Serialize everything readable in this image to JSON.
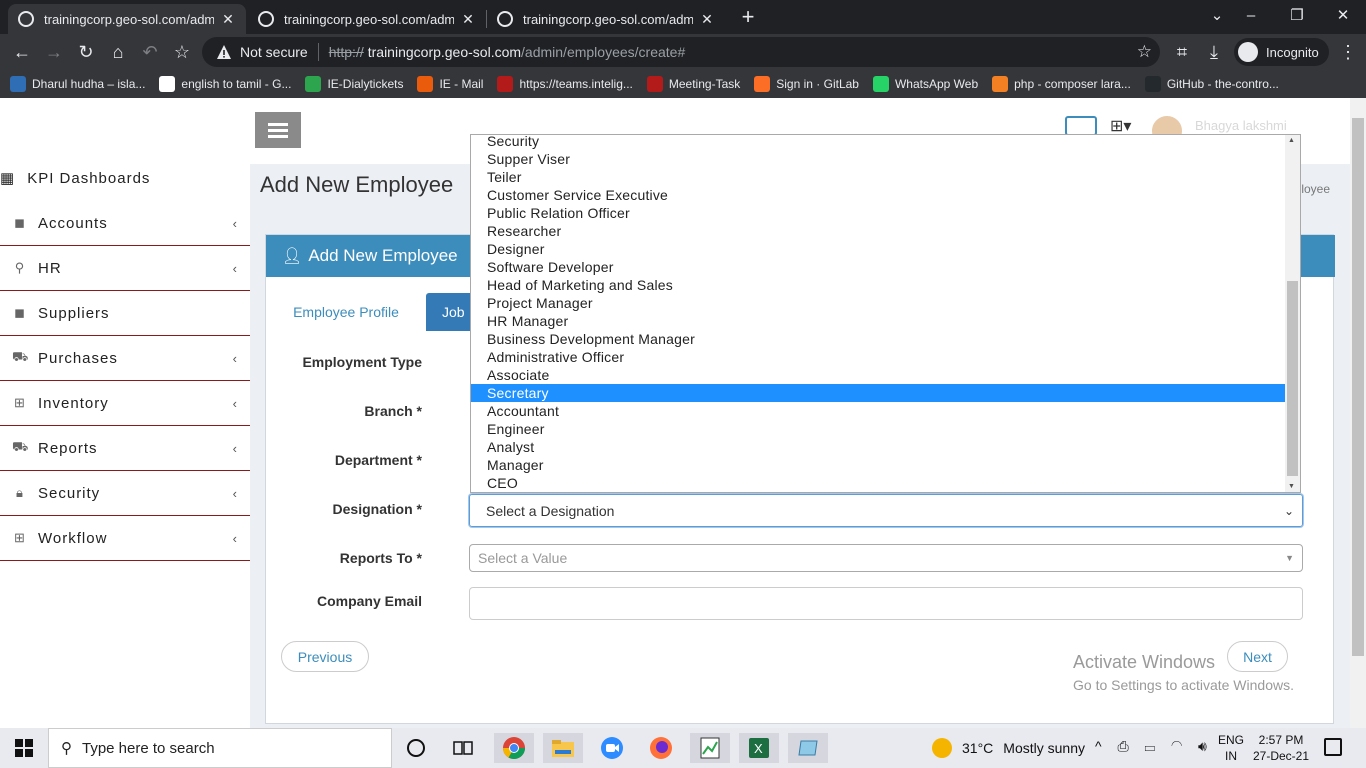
{
  "browser": {
    "tabs": [
      {
        "title": "trainingcorp.geo-sol.com/admin/"
      },
      {
        "title": "trainingcorp.geo-sol.com/admin/"
      },
      {
        "title": "trainingcorp.geo-sol.com/admin/"
      }
    ],
    "address": {
      "security_label": "Not secure",
      "scheme": "http://",
      "host": "trainingcorp.geo-sol.com",
      "path": "/admin/employees/create#"
    },
    "profile_label": "Incognito",
    "bookmarks": [
      {
        "label": "Dharul hudha – isla...",
        "color": "#2f6db5"
      },
      {
        "label": "english to tamil - G...",
        "color": "#ffffff"
      },
      {
        "label": "IE-Dialytickets",
        "color": "#2da44e"
      },
      {
        "label": "IE - Mail",
        "color": "#ea5b0c"
      },
      {
        "label": "https://teams.intelig...",
        "color": "#b31b1b"
      },
      {
        "label": "Meeting-Task",
        "color": "#b31b1b"
      },
      {
        "label": "Sign in · GitLab",
        "color": "#fc6d26"
      },
      {
        "label": "WhatsApp Web",
        "color": "#25d366"
      },
      {
        "label": "php - composer lara...",
        "color": "#f48024"
      },
      {
        "label": "GitHub - the-contro...",
        "color": "#24292e"
      }
    ]
  },
  "sidebar": {
    "kpi_label": "KPI Dashboards",
    "items": [
      {
        "label": "Accounts"
      },
      {
        "label": "HR"
      },
      {
        "label": "Suppliers"
      },
      {
        "label": "Purchases"
      },
      {
        "label": "Inventory"
      },
      {
        "label": "Reports"
      },
      {
        "label": "Security"
      },
      {
        "label": "Workflow"
      }
    ]
  },
  "header": {
    "page_title": "Add New Employee",
    "breadcrumb_tail": "loyee",
    "user_name": "Bhagya lakshmi"
  },
  "form": {
    "box_title": "Add New Employee",
    "tabs": {
      "profile": "Employee Profile",
      "job": "Job"
    },
    "labels": {
      "employment_type": "Employment Type",
      "branch": "Branch *",
      "department": "Department *",
      "designation": "Designation *",
      "reports_to": "Reports To *",
      "company_email": "Company Email"
    },
    "designation_value": "Select a Designation",
    "reports_to_placeholder": "Select a Value",
    "company_email_value": "",
    "previous_label": "Previous",
    "next_label": "Next"
  },
  "dropdown": {
    "options": [
      {
        "label": "Security",
        "selected": false
      },
      {
        "label": "Supper Viser",
        "selected": false
      },
      {
        "label": "Teiler",
        "selected": false
      },
      {
        "label": "Customer Service Executive",
        "selected": false
      },
      {
        "label": "Public Relation Officer",
        "selected": false
      },
      {
        "label": "Researcher",
        "selected": false
      },
      {
        "label": "Designer",
        "selected": false
      },
      {
        "label": "Software Developer",
        "selected": false
      },
      {
        "label": "Head of Marketing and Sales",
        "selected": false
      },
      {
        "label": "Project Manager",
        "selected": false
      },
      {
        "label": "HR Manager",
        "selected": false
      },
      {
        "label": "Business Development Manager",
        "selected": false
      },
      {
        "label": "Administrative Officer",
        "selected": false
      },
      {
        "label": "Associate",
        "selected": false
      },
      {
        "label": "Secretary",
        "selected": true
      },
      {
        "label": "Accountant",
        "selected": false
      },
      {
        "label": "Engineer",
        "selected": false
      },
      {
        "label": "Analyst",
        "selected": false
      },
      {
        "label": "Manager",
        "selected": false
      },
      {
        "label": "CEO",
        "selected": false
      }
    ]
  },
  "watermark": {
    "title": "Activate Windows",
    "subtitle": "Go to Settings to activate Windows."
  },
  "taskbar": {
    "search_placeholder": "Type here to search",
    "weather": {
      "temp": "31°C",
      "condition": "Mostly sunny"
    },
    "lang": {
      "line1": "ENG",
      "line2": "IN"
    },
    "clock": {
      "time": "2:57 PM",
      "date": "27-Dec-21"
    }
  },
  "colors": {
    "accent": "#3c8dbc",
    "sidebar_divider": "#8b1a1a",
    "selection": "#1e90ff"
  }
}
